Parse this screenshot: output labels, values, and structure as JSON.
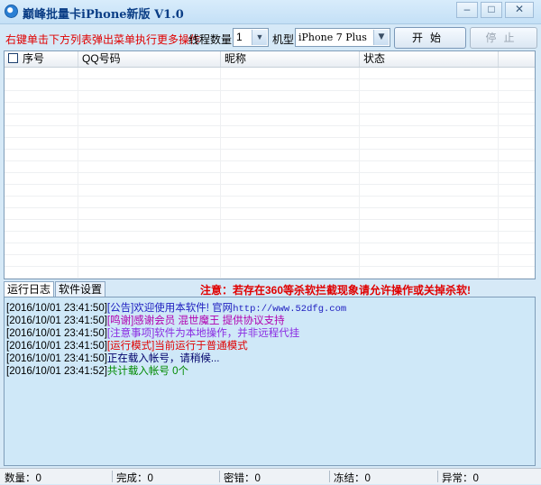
{
  "window": {
    "title": "巅峰批量卡iPhone新版  V1.0"
  },
  "toolbar": {
    "hint": "右键单击下方列表弹出菜单执行更多操作",
    "threads_label": "线程数量：",
    "threads_value": "1",
    "model_label": "机型",
    "model_value": "iPhone 7 Plus",
    "start_label": "开始",
    "stop_label": "停止"
  },
  "grid": {
    "columns": [
      "序号",
      "QQ号码",
      "昵称",
      "状态"
    ],
    "rows": []
  },
  "tabs": [
    {
      "label": "运行日志"
    },
    {
      "label": "软件设置"
    }
  ],
  "warning": "注意：若存在360等杀软拦截现象请允许操作或关掉杀软!",
  "colors": {
    "notice": "#2020c0",
    "thanks": "#b000b0",
    "caution": "#8a2be2",
    "mode": "#e00000",
    "loading": "#00006a",
    "loaded": "#008a00",
    "warning": "#e00000"
  },
  "log": [
    {
      "ts": "[2016/10/01  23:41:50]",
      "text": "[公告]欢迎使用本软件! 官网",
      "extra": "http://www.52dfg.com"
    },
    {
      "ts": "[2016/10/01  23:41:50]",
      "text": "[鸣谢]感谢会员  混世魔王  提供协议支持",
      "extra": ""
    },
    {
      "ts": "[2016/10/01  23:41:50]",
      "text": "[注意事项]软件为本地操作，并非远程代挂",
      "extra": ""
    },
    {
      "ts": "[2016/10/01  23:41:50]",
      "text": "[运行模式]当前运行于普通模式",
      "extra": ""
    },
    {
      "ts": "[2016/10/01  23:41:50]",
      "text": "正在载入帐号，请稍候...",
      "extra": ""
    },
    {
      "ts": "[2016/10/01  23:41:52]",
      "text": "共计载入帐号  0个",
      "extra": ""
    }
  ],
  "status": {
    "count": "数量：0",
    "done": "完成：0",
    "bad_pwd": "密错：0",
    "frozen": "冻结：0",
    "error": "异常：0"
  }
}
